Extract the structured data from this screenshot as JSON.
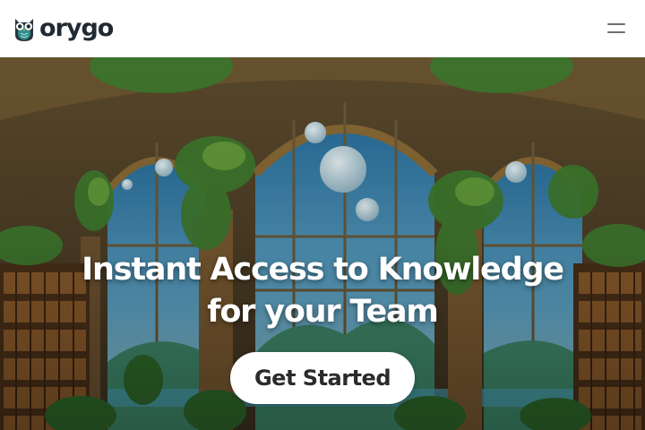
{
  "brand": {
    "name": "orygo",
    "logo_icon": "owl-icon"
  },
  "header": {
    "menu_icon": "hamburger-menu-icon"
  },
  "hero": {
    "title_line1": "Instant Access to Knowledge",
    "title_line2": "for your Team",
    "cta_label": "Get Started",
    "background": "fantasy library with arched windows, planets and hanging plants"
  },
  "colors": {
    "brand_text": "#1f2a33",
    "owl_teal": "#2f8f8a",
    "cta_bg": "#ffffff",
    "cta_text": "#2b2b2b"
  }
}
